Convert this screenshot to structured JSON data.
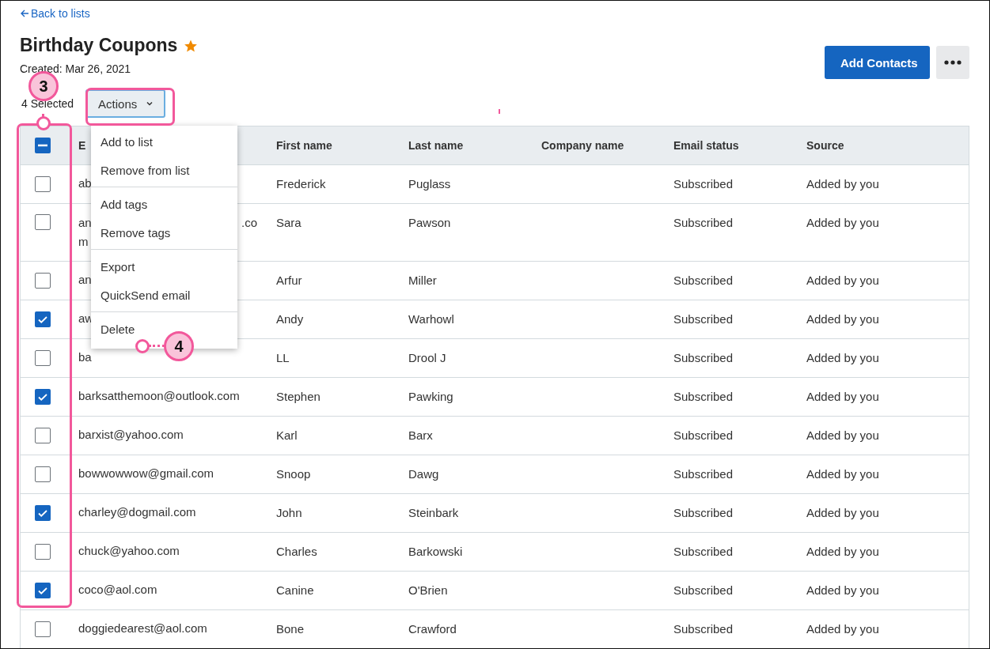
{
  "back_link": {
    "label": "Back to lists"
  },
  "title": "Birthday Coupons",
  "favorite": true,
  "created": "Created: Mar 26, 2021",
  "buttons": {
    "primary": "Add Contacts"
  },
  "selection": {
    "count_label": "4 Selected",
    "actions_label": "Actions"
  },
  "actions_menu": [
    {
      "items": [
        "Add to list",
        "Remove from list"
      ]
    },
    {
      "items": [
        "Add tags",
        "Remove tags"
      ]
    },
    {
      "items": [
        "Export",
        "QuickSend email"
      ]
    },
    {
      "items": [
        "Delete"
      ]
    }
  ],
  "table": {
    "header_checkbox": {
      "indeterminate": true
    },
    "columns": [
      "E",
      "First name",
      "Last name",
      "Company name",
      "Email status",
      "Source"
    ],
    "rows": [
      {
        "checked": false,
        "email": "ab",
        "first": "Frederick",
        "last": "Puglass",
        "status": "Subscribed",
        "source": "Added by you"
      },
      {
        "checked": false,
        "email": "an",
        "email_tail": ".co",
        "email_wrap": "m",
        "first": "Sara",
        "last": "Pawson",
        "status": "Subscribed",
        "source": "Added by you"
      },
      {
        "checked": false,
        "email": "an",
        "first": "Arfur",
        "last": "Miller",
        "status": "Subscribed",
        "source": "Added by you"
      },
      {
        "checked": true,
        "email": "aw",
        "first": "Andy",
        "last": "Warhowl",
        "status": "Subscribed",
        "source": "Added by you"
      },
      {
        "checked": false,
        "email": "ba",
        "first": "LL",
        "last": "Drool J",
        "status": "Subscribed",
        "source": "Added by you"
      },
      {
        "checked": true,
        "email": "barksatthemoon@outlook.com",
        "first": "Stephen",
        "last": "Pawking",
        "status": "Subscribed",
        "source": "Added by you"
      },
      {
        "checked": false,
        "email": "barxist@yahoo.com",
        "first": "Karl",
        "last": "Barx",
        "status": "Subscribed",
        "source": "Added by you"
      },
      {
        "checked": false,
        "email": "bowwowwow@gmail.com",
        "first": "Snoop",
        "last": "Dawg",
        "status": "Subscribed",
        "source": "Added by you"
      },
      {
        "checked": true,
        "email": "charley@dogmail.com",
        "first": "John",
        "last": "Steinbark",
        "status": "Subscribed",
        "source": "Added by you"
      },
      {
        "checked": false,
        "email": "chuck@yahoo.com",
        "first": "Charles",
        "last": "Barkowski",
        "status": "Subscribed",
        "source": "Added by you"
      },
      {
        "checked": true,
        "email": "coco@aol.com",
        "first": "Canine",
        "last": "O'Brien",
        "status": "Subscribed",
        "source": "Added by you"
      },
      {
        "checked": false,
        "email": "doggiedearest@aol.com",
        "first": "Bone",
        "last": "Crawford",
        "status": "Subscribed",
        "source": "Added by you"
      }
    ]
  },
  "annotations": [
    {
      "label": "3"
    },
    {
      "label": "4"
    }
  ]
}
